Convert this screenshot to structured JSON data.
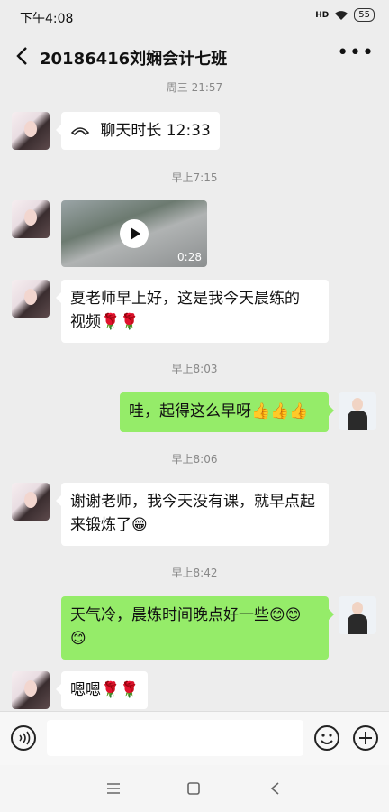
{
  "status": {
    "time": "下午4:08",
    "signal": "HD",
    "battery": "55"
  },
  "header": {
    "title": "20186416刘娴会计七班",
    "back_icon": "back-chevron-icon",
    "more_icon": "more-icon"
  },
  "chat": {
    "timestamps": [
      "周三 21:57",
      "早上7:15",
      "早上8:03",
      "早上8:06",
      "早上8:42"
    ],
    "call_message": {
      "label": "聊天时长 12:33"
    },
    "video_message": {
      "duration": "0:28"
    },
    "messages": [
      {
        "sender": "other",
        "text_line1": "夏老师早上好，这是我今天晨练的",
        "text_line2": "视频🌹🌹"
      },
      {
        "sender": "me",
        "text": "哇，起得这么早呀👍👍👍"
      },
      {
        "sender": "other",
        "text_line1": "谢谢老师，我今天没有课，就早点起",
        "text_line2": "来锻炼了😁"
      },
      {
        "sender": "me",
        "text_line1": "天气冷，晨炼时间晚点好一些😊😊",
        "text_line2": "😊"
      },
      {
        "sender": "other",
        "text": "嗯嗯🌹🌹"
      }
    ]
  },
  "input_bar": {
    "voice_icon": "voice-icon",
    "emoji_icon": "emoji-icon",
    "plus_icon": "plus-icon",
    "value": ""
  },
  "nav_bar": {
    "menu_icon": "menu-icon",
    "home_icon": "home-icon",
    "back_icon": "back-icon"
  }
}
